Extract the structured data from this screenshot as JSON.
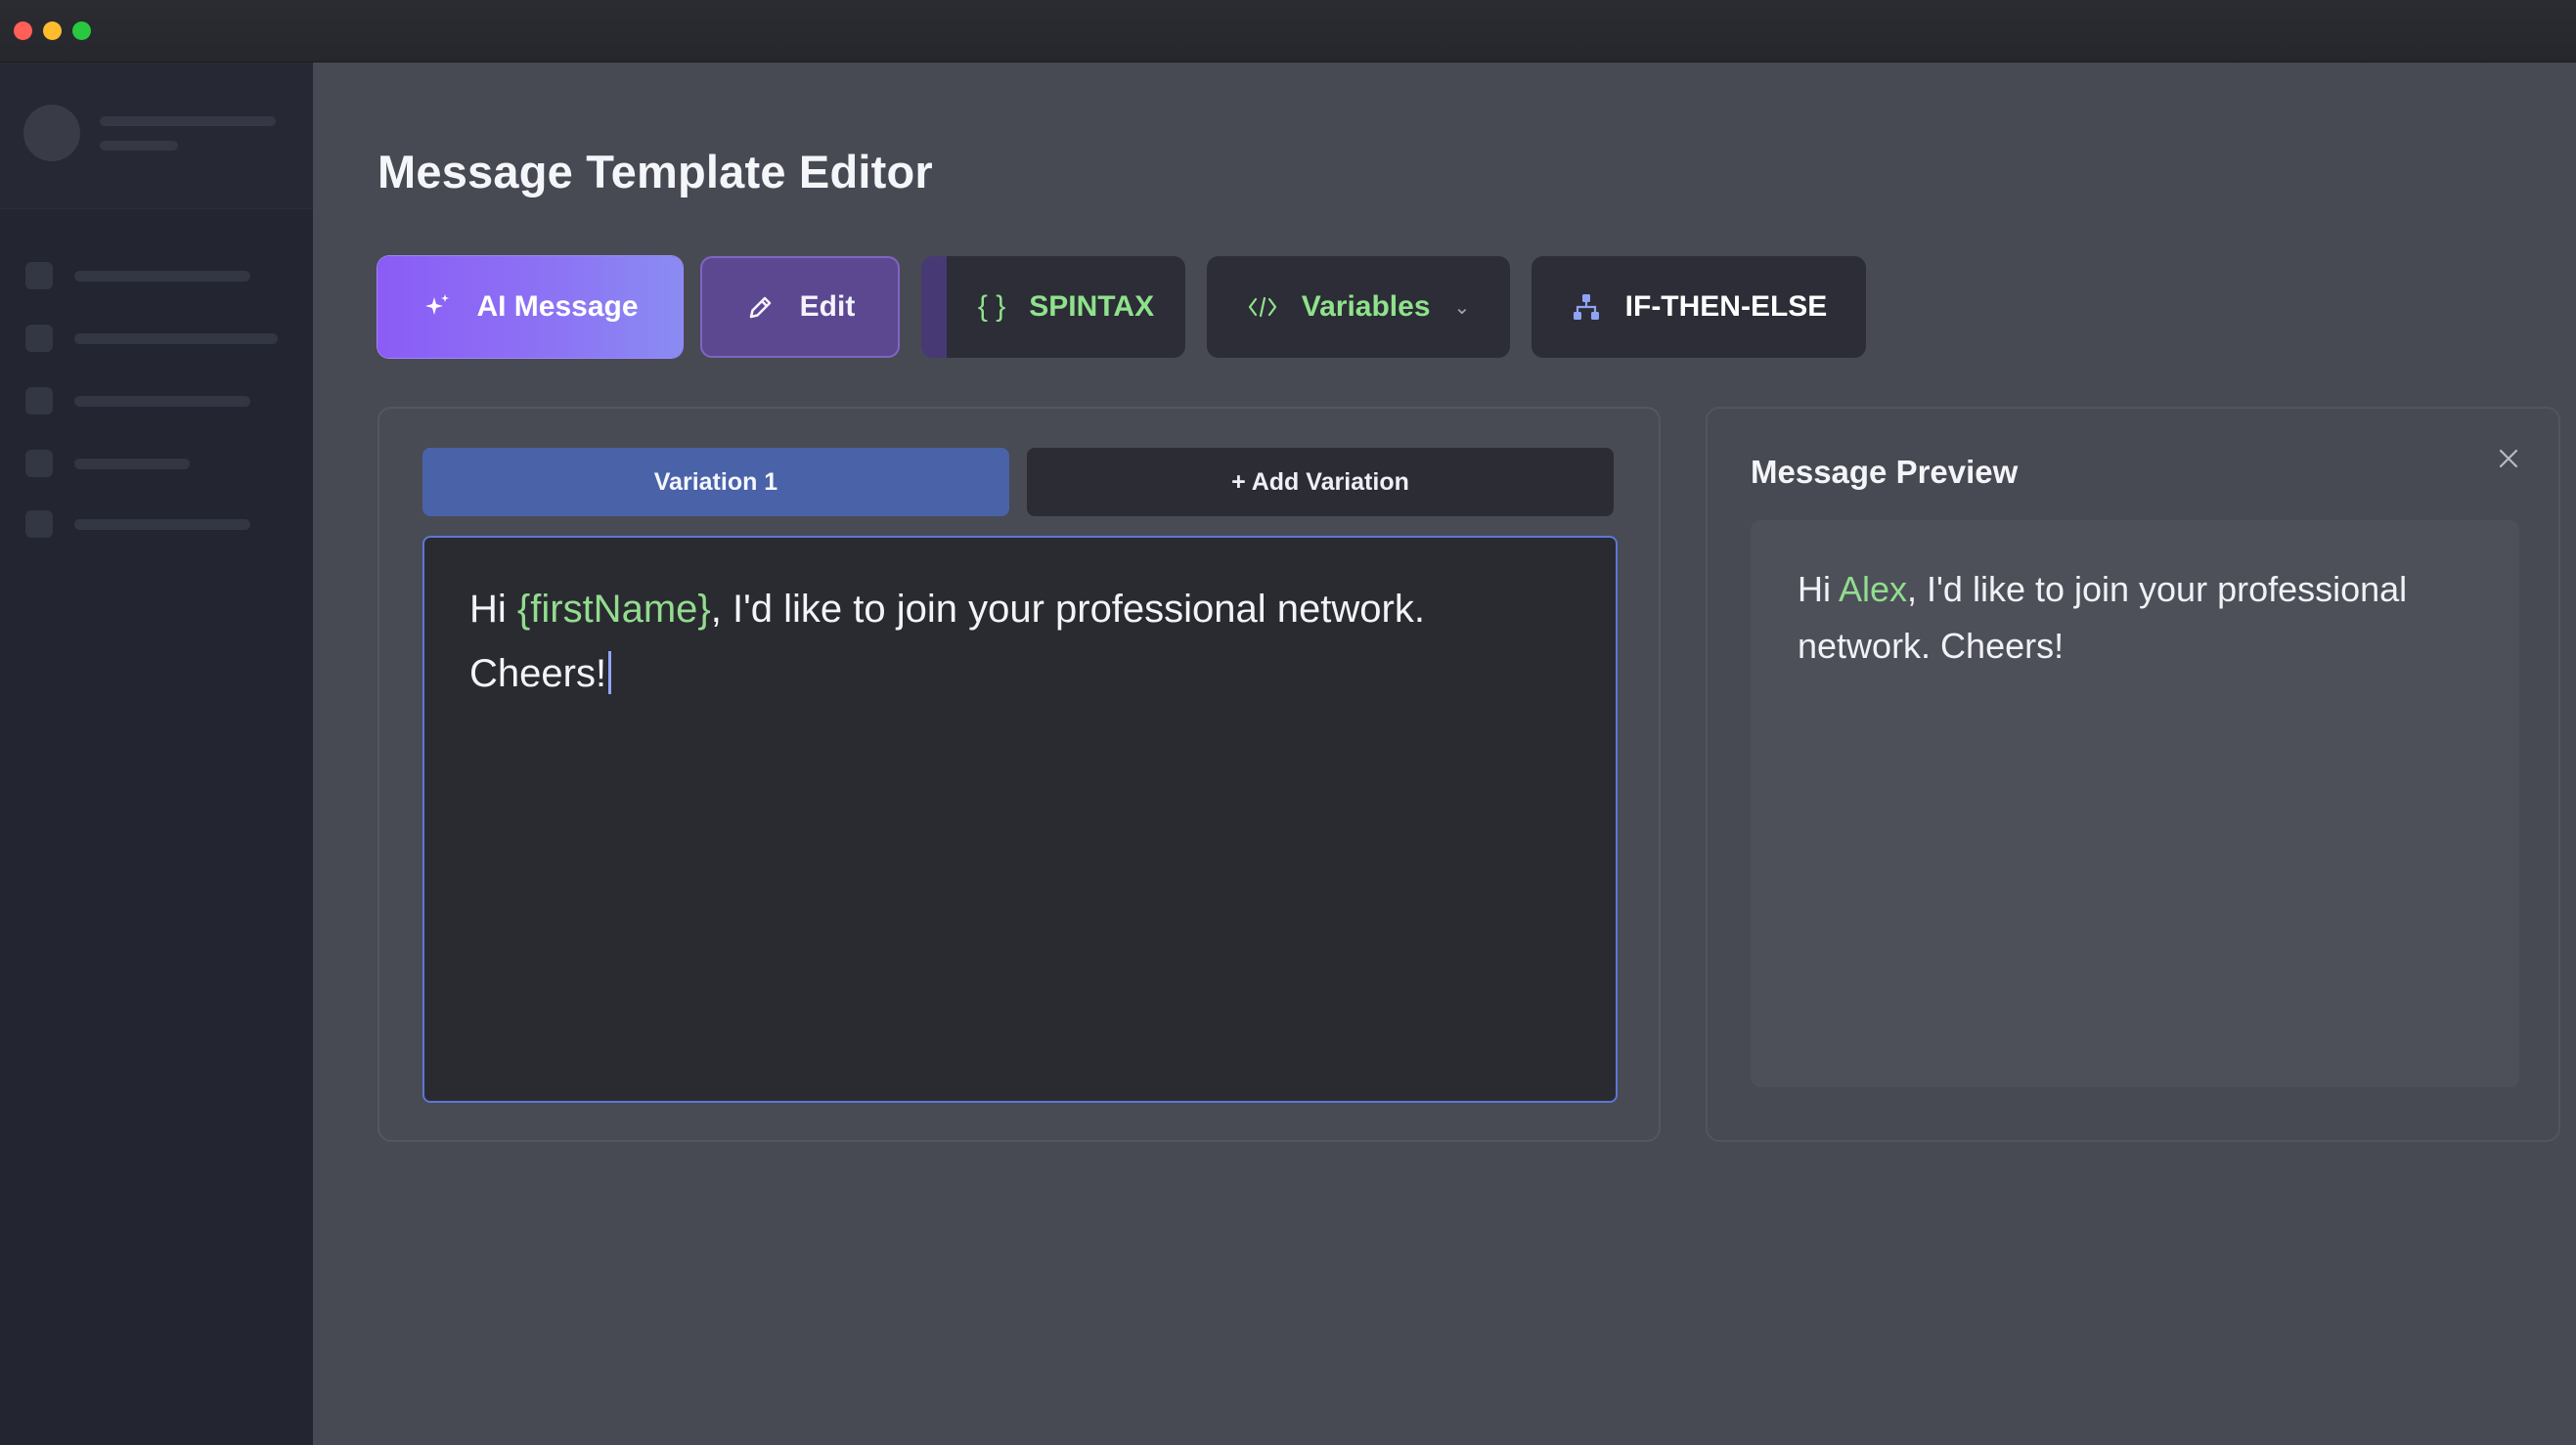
{
  "window": {
    "controls": [
      "close",
      "minimize",
      "zoom"
    ]
  },
  "page": {
    "title": "Message Template Editor"
  },
  "toolbar": {
    "ai_message": {
      "label": "AI Message",
      "icon": "sparkles-icon"
    },
    "edit": {
      "label": "Edit",
      "icon": "pencil-icon"
    },
    "spintax": {
      "label": "SPINTAX",
      "icon": "curly-braces-icon"
    },
    "variables": {
      "label": "Variables",
      "icon": "code-icon"
    },
    "if_then_else": {
      "label": "IF-THEN-ELSE",
      "icon": "branch-icon"
    }
  },
  "editor": {
    "tabs": [
      {
        "label": "Variation 1",
        "active": true
      },
      {
        "label": "+ Add Variation",
        "active": false
      }
    ],
    "message": {
      "prefix": "Hi ",
      "variable": "{firstName}",
      "line1_rest": ", I'd like to join your professional network.",
      "line2": "Cheers!"
    }
  },
  "preview": {
    "title": "Message Preview",
    "message": {
      "prefix": "Hi ",
      "name": "Alex",
      "line1_rest": ", I'd like to join your professional",
      "line2": "network. Cheers!"
    }
  },
  "colors": {
    "accent_purple": "#8b5cf6",
    "variable_green": "#93dc8f",
    "active_tab_blue": "#4a62a8"
  }
}
